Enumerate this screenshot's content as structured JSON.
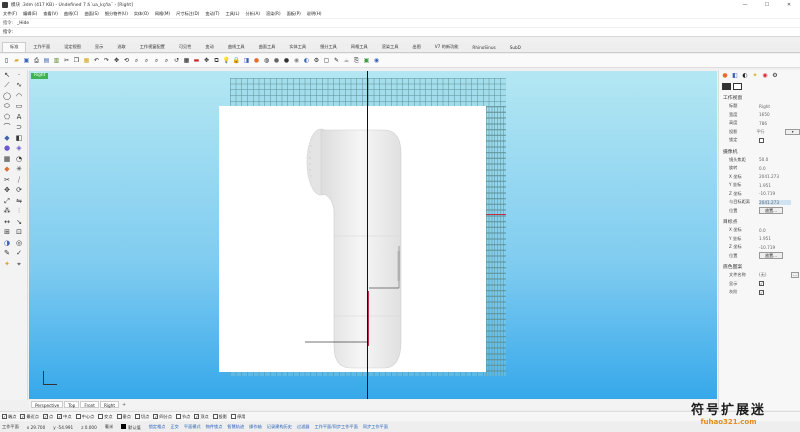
{
  "window": {
    "title": "模块 .3dm (417 KB) - Undefined 7 ã´ua_kçña¨ - [Right]",
    "buttons": [
      "—",
      "☐",
      "✕"
    ]
  },
  "menubar": {
    "items": [
      "文件(F)",
      "编辑(E)",
      "查看(V)",
      "曲线(C)",
      "曲面(S)",
      "细分物件(U)",
      "实体(O)",
      "网格(M)",
      "尺寸标注(D)",
      "变动(T)",
      "工具(L)",
      "分析(A)",
      "渲染(R)",
      "面板(P)",
      "说明(H)"
    ]
  },
  "command": {
    "history_label": "指令:",
    "history_value": "_Hide",
    "prompt_label": "指令:",
    "input_value": ""
  },
  "tabs": [
    "标准",
    "工作平面",
    "设定视图",
    "显示",
    "选取",
    "工作视窗配置",
    "可见性",
    "变动",
    "曲线工具",
    "曲面工具",
    "实体工具",
    "细分工具",
    "网格工具",
    "渲染工具",
    "出图",
    "V7 的新功能",
    "RhinoSinus",
    "SubD"
  ],
  "viewport": {
    "label": "Right",
    "tabs": [
      "Perspective",
      "Top",
      "Front",
      "Right"
    ],
    "add": "+"
  },
  "osnaps": [
    {
      "label": "端点",
      "checked": true
    },
    {
      "label": "最近点",
      "checked": true
    },
    {
      "label": "点",
      "checked": true
    },
    {
      "label": "中点",
      "checked": true
    },
    {
      "label": "中心点",
      "checked": false
    },
    {
      "label": "交点",
      "checked": false
    },
    {
      "label": "垂点",
      "checked": false
    },
    {
      "label": "切点",
      "checked": false
    },
    {
      "label": "四分点",
      "checked": true
    },
    {
      "label": "节点",
      "checked": false
    },
    {
      "label": "顶点",
      "checked": true
    },
    {
      "label": "投影",
      "checked": false
    },
    {
      "label": "停用",
      "checked": false
    }
  ],
  "status": {
    "plane": "工作平面",
    "x": "x 29.700",
    "y": "y -54.991",
    "z": "z 0.000",
    "unit": "毫米",
    "layer": "默认值",
    "modes": [
      "锁定格点",
      "正交",
      "平面模式",
      "物件锁点",
      "智慧轨迹",
      "操作轴",
      "记录建构历史",
      "过滤器",
      "工作平面/同步工作平面",
      "同步工作平面"
    ]
  },
  "panel": {
    "section_viewport": "工作视窗",
    "rows_viewport": [
      {
        "k": "标题",
        "v": "Right"
      },
      {
        "k": "宽度",
        "v": "1650"
      },
      {
        "k": "高度",
        "v": "786"
      },
      {
        "k": "投影",
        "v": "平行"
      }
    ],
    "locked_label": "锁定",
    "section_camera": "摄像机",
    "rows_camera": [
      {
        "k": "镜头焦距",
        "v": "50.0"
      },
      {
        "k": "旋转",
        "v": "0.0"
      },
      {
        "k": "X 坐标",
        "v": "2041.273"
      },
      {
        "k": "Y 坐标",
        "v": "1.951"
      },
      {
        "k": "Z 坐标",
        "v": "-10.719"
      },
      {
        "k": "与目标距离",
        "v": "2041.273"
      }
    ],
    "location_label": "位置",
    "place_btn": "放置...",
    "section_target": "目标点",
    "rows_target": [
      {
        "k": "X 坐标",
        "v": "0.0"
      },
      {
        "k": "Y 坐标",
        "v": "1.951"
      },
      {
        "k": "Z 坐标",
        "v": "-10.719"
      }
    ],
    "section_wallpaper": "底色图案",
    "file_label": "文件名称",
    "file_value": "(无)",
    "show_label": "显示",
    "gray_label": "灰阶"
  },
  "watermark": {
    "main": "符号扩展迷",
    "sub": "fuhao321.com"
  }
}
